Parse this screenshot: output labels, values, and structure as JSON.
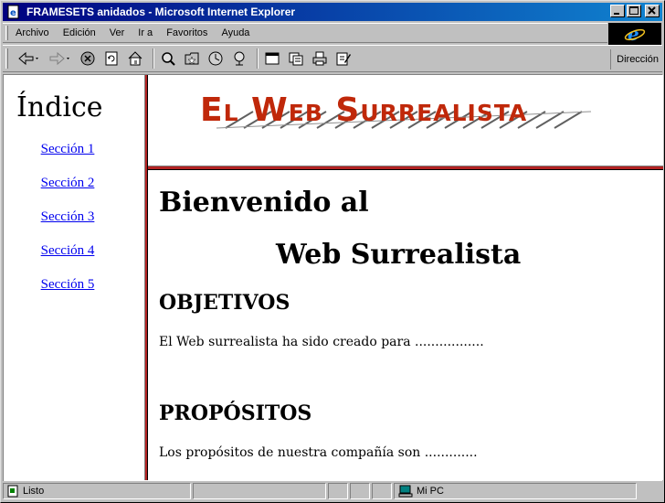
{
  "window": {
    "title": "FRAMESETS anidados - Microsoft Internet Explorer",
    "controls": [
      "minimize",
      "maximize",
      "close"
    ]
  },
  "menu": {
    "items": [
      {
        "label": "Archivo"
      },
      {
        "label": "Edición"
      },
      {
        "label": "Ver"
      },
      {
        "label": "Ir a"
      },
      {
        "label": "Favoritos"
      },
      {
        "label": "Ayuda"
      }
    ]
  },
  "toolbar": {
    "buttons": [
      "back-icon",
      "forward-icon",
      "stop-icon",
      "refresh-icon",
      "home-icon",
      "search-icon",
      "favorites-icon",
      "history-icon",
      "channels-icon",
      "fullscreen-icon",
      "mail-icon",
      "print-icon",
      "edit-icon"
    ],
    "address_label": "Dirección"
  },
  "left_frame": {
    "heading": "Índice",
    "links": [
      {
        "label": "Sección 1"
      },
      {
        "label": "Sección 2"
      },
      {
        "label": "Sección 3"
      },
      {
        "label": "Sección 4"
      },
      {
        "label": "Sección 5"
      }
    ]
  },
  "top_frame": {
    "logo_text": "El Web Surrealista"
  },
  "main_frame": {
    "title_line1": "Bienvenido al",
    "title_line2": "Web Surrealista",
    "section1_heading": "OBJETIVOS",
    "section1_text": "El Web surrealista ha sido creado para .................",
    "section2_heading": "PROPÓSITOS",
    "section2_text": "Los propósitos de nuestra compañía son ............."
  },
  "statusbar": {
    "status": "Listo",
    "zone": "Mi PC"
  },
  "colors": {
    "titlebar_start": "#000080",
    "titlebar_end": "#1084d0",
    "logo": "#c0280a",
    "frame_border": "#b22222",
    "link": "#0000ee"
  }
}
